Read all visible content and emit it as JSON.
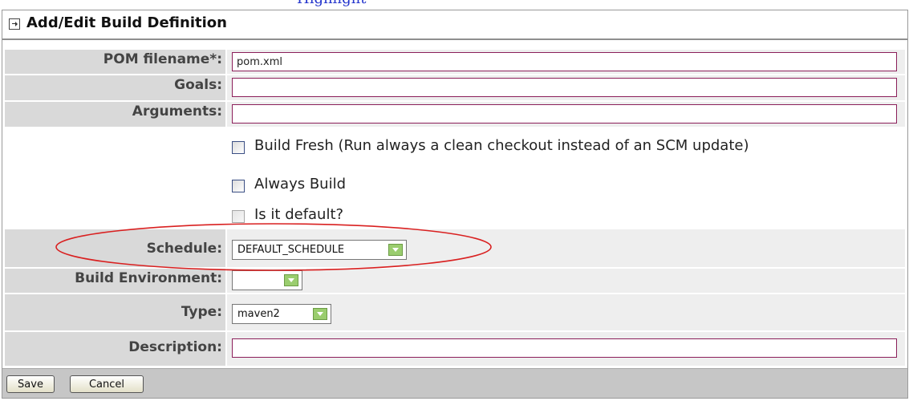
{
  "top_link": "Highlight",
  "panel": {
    "title": "Add/Edit Build Definition"
  },
  "fields": {
    "pom_filename": {
      "label": "POM filename*:",
      "value": "pom.xml"
    },
    "goals": {
      "label": "Goals:",
      "value": ""
    },
    "arguments": {
      "label": "Arguments:",
      "value": ""
    },
    "schedule": {
      "label": "Schedule:",
      "value": "DEFAULT_SCHEDULE"
    },
    "build_environment": {
      "label": "Build Environment:",
      "value": ""
    },
    "type": {
      "label": "Type:",
      "value": "maven2"
    },
    "description": {
      "label": "Description:",
      "value": ""
    }
  },
  "checkboxes": {
    "build_fresh": {
      "label": "Build Fresh (Run always a clean checkout instead of an SCM update)",
      "checked": false
    },
    "always_build": {
      "label": "Always Build",
      "checked": false
    },
    "is_default": {
      "label": "Is it default?",
      "checked": false,
      "disabled": true
    }
  },
  "buttons": {
    "save": "Save",
    "cancel": "Cancel"
  },
  "colors": {
    "label_background": "#d9d9d9",
    "field_background": "#eeeeee",
    "input_border": "#8b1f5a",
    "highlight_ellipse": "#d92020",
    "dropdown_arrow": "#9acd6e",
    "button_bar": "#c6c6c6"
  },
  "icons": {
    "panel_toggle": "collapse-panel-icon",
    "dropdown": "chevron-down-icon"
  }
}
